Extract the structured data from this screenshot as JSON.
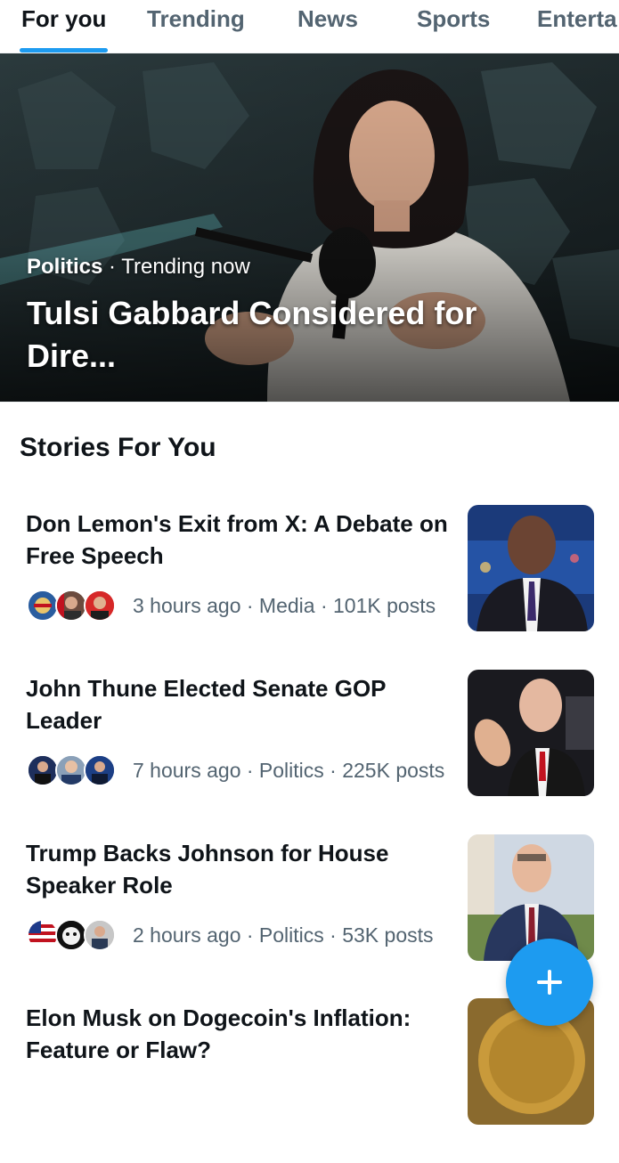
{
  "tabs": [
    {
      "label": "For you",
      "active": true
    },
    {
      "label": "Trending",
      "active": false
    },
    {
      "label": "News",
      "active": false
    },
    {
      "label": "Sports",
      "active": false
    },
    {
      "label": "Enterta",
      "active": false
    }
  ],
  "hero": {
    "category": "Politics",
    "separator": " · ",
    "status": "Trending now",
    "title": "Tulsi Gabbard Considered for Dire..."
  },
  "section_title": "Stories For You",
  "stories": [
    {
      "title": "Don Lemon's Exit from X: A Debate on Free Speech",
      "meta": "3 hours ago · Media · 101K posts",
      "avatar_icons": [
        "badge-avatar-icon",
        "person-avatar-icon",
        "person-avatar-icon"
      ],
      "thumb_icon": "news-anchor-photo-icon"
    },
    {
      "title": "John Thune Elected Senate GOP Leader",
      "meta": "7 hours ago · Politics · 225K posts",
      "avatar_icons": [
        "person-avatar-icon",
        "person-avatar-icon",
        "person-avatar-icon"
      ],
      "thumb_icon": "politician-photo-icon"
    },
    {
      "title": "Trump Backs Johnson for House Speaker Role",
      "meta": "2 hours ago · Politics · 53K posts",
      "avatar_icons": [
        "flag-avatar-icon",
        "cartoon-avatar-icon",
        "person-avatar-icon"
      ],
      "thumb_icon": "politician-photo-icon"
    },
    {
      "title": "Elon Musk on Dogecoin's Inflation: Feature or Flaw?",
      "meta": "",
      "avatar_icons": [],
      "thumb_icon": "coin-photo-icon"
    }
  ],
  "fab": {
    "icon": "plus-icon"
  },
  "colors": {
    "accent": "#1d9bf0",
    "text_primary": "#0f1419",
    "text_secondary": "#536471"
  }
}
